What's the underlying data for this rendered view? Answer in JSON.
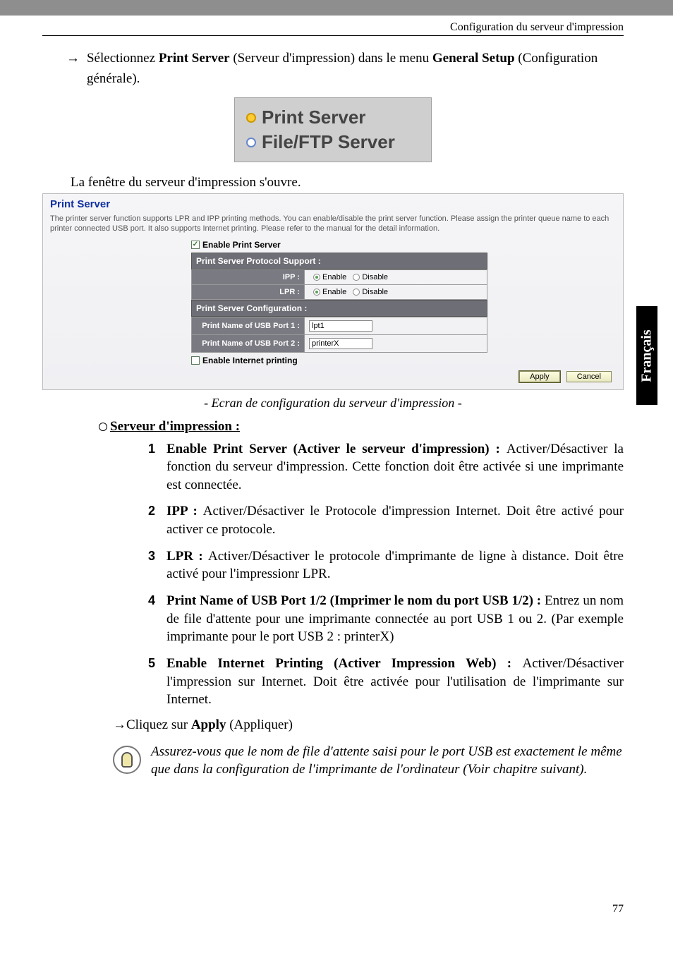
{
  "header": {
    "doc_title": "Configuration du serveur d'impression"
  },
  "step1": {
    "arrow": "→",
    "pre": "Sélectionnez ",
    "bold1": "Print Server",
    "mid1": " (Serveur d'impression) dans le menu ",
    "bold2": "General Setup",
    "post": " (Configuration générale)."
  },
  "menu_img": {
    "opt1": "Print Server",
    "opt2": "File/FTP Server"
  },
  "intro2": "La fenêtre du serveur d'impression s'ouvre.",
  "ps": {
    "title": "Print Server",
    "desc": "The printer server function supports LPR and IPP printing methods. You can enable/disable the print server function. Please assign the printer queue name to each printer connected USB port. It also supports Internet printing. Please refer to the manual for the detail information.",
    "chk_enable": "Enable Print Server",
    "sec1": "Print Server Protocol Support :",
    "ipp_label": "IPP :",
    "lpr_label": "LPR :",
    "enable": "Enable",
    "disable": "Disable",
    "sec2": "Print Server Configuration :",
    "port1_label": "Print Name of USB Port 1 :",
    "port1_value": "lpt1",
    "port2_label": "Print Name of USB Port 2 :",
    "port2_value": "printerX",
    "chk_internet": "Enable Internet printing",
    "apply": "Apply",
    "cancel": "Cancel"
  },
  "caption": "- Ecran de configuration du serveur d'impression -",
  "subheading": "Serveur d'impression :",
  "items": [
    {
      "n": "1",
      "lead": "Enable Print Server (Activer le serveur d'impression) : ",
      "rest": "Activer/Désactiver la fonction du serveur d'impression. Cette fonction doit être activée si une imprimante est connectée."
    },
    {
      "n": "2",
      "lead": "IPP : ",
      "rest": "Activer/Désactiver le Protocole d'impression Internet. Doit être activé pour activer ce protocole."
    },
    {
      "n": "3",
      "lead": "LPR : ",
      "rest": "Activer/Désactiver le protocole d'imprimante de ligne à distance. Doit être activé pour l'impressionr LPR."
    },
    {
      "n": "4",
      "lead": "Print Name of USB Port 1/2 (Imprimer le nom du port USB 1/2) : ",
      "rest": "Entrez un nom de file d'attente pour une imprimante connectée au port USB 1 ou 2. (Par exemple imprimante pour le port USB 2 : printerX)"
    },
    {
      "n": "5",
      "lead": "Enable Internet Printing (Activer Impression Web) : ",
      "rest": "Activer/Désactiver l'impression sur Internet. Doit être activée pour l'utilisation de l'imprimante sur Internet."
    }
  ],
  "apply_line": {
    "arrow": "→",
    "pre": "Cliquez sur ",
    "bold": "Apply",
    "post": " (Appliquer)"
  },
  "note": "Assurez-vous que le nom de file d'attente saisi pour le port USB est exactement le même que dans la configuration de l'imprimante de l'ordinateur (Voir chapitre suivant).",
  "side": "Français",
  "page": "77"
}
